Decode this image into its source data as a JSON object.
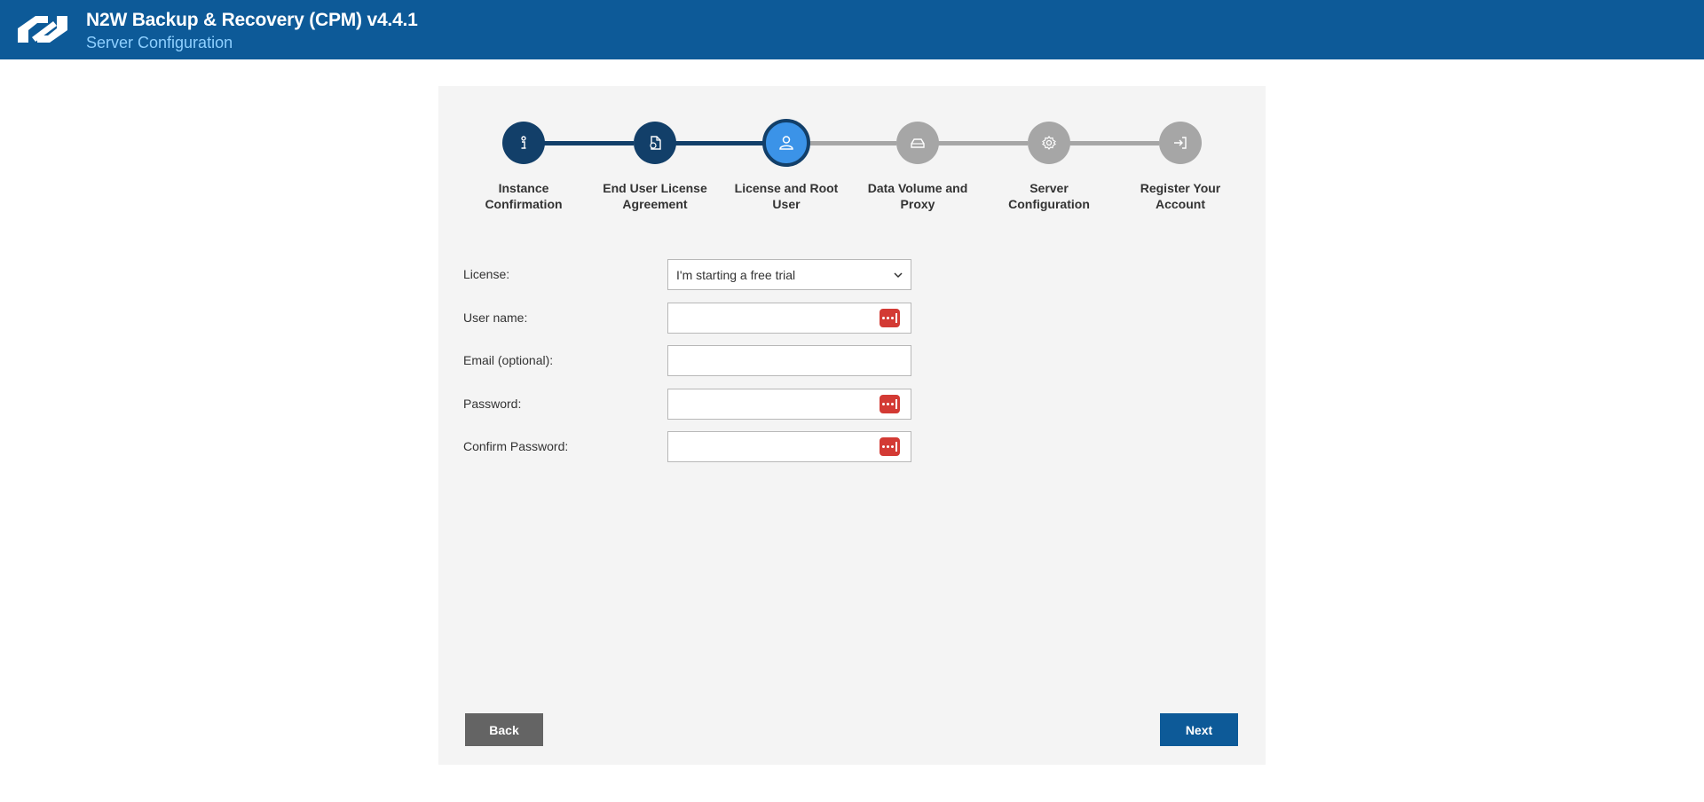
{
  "header": {
    "title": "N2W Backup & Recovery (CPM) v4.4.1",
    "subtitle": "Server Configuration",
    "background_color": "#0d5a98",
    "subtitle_color": "#8fd0ff"
  },
  "wizard": {
    "steps": [
      {
        "label_line1": "Instance",
        "label_line2": "Confirmation",
        "icon": "info-icon",
        "state": "done"
      },
      {
        "label_line1": "End User License",
        "label_line2": "Agreement",
        "icon": "document-icon",
        "state": "done"
      },
      {
        "label_line1": "License and Root",
        "label_line2": "User",
        "icon": "user-icon",
        "state": "active"
      },
      {
        "label_line1": "Data Volume and",
        "label_line2": "Proxy",
        "icon": "drive-icon",
        "state": "pending"
      },
      {
        "label_line1": "Server",
        "label_line2": "Configuration",
        "icon": "gear-icon",
        "state": "pending"
      },
      {
        "label_line1": "Register Your",
        "label_line2": "Account",
        "icon": "sign-in-icon",
        "state": "pending"
      }
    ],
    "colors": {
      "done": "#123f69",
      "active": "#3b93e8",
      "pending": "#a6a6a6"
    }
  },
  "form": {
    "license": {
      "label": "License:",
      "selected": "I'm starting a free trial"
    },
    "username": {
      "label": "User name:",
      "value": ""
    },
    "email": {
      "label": "Email (optional):",
      "value": ""
    },
    "password": {
      "label": "Password:",
      "value": ""
    },
    "confirm_password": {
      "label": "Confirm Password:",
      "value": ""
    }
  },
  "buttons": {
    "back": "Back",
    "next": "Next"
  }
}
